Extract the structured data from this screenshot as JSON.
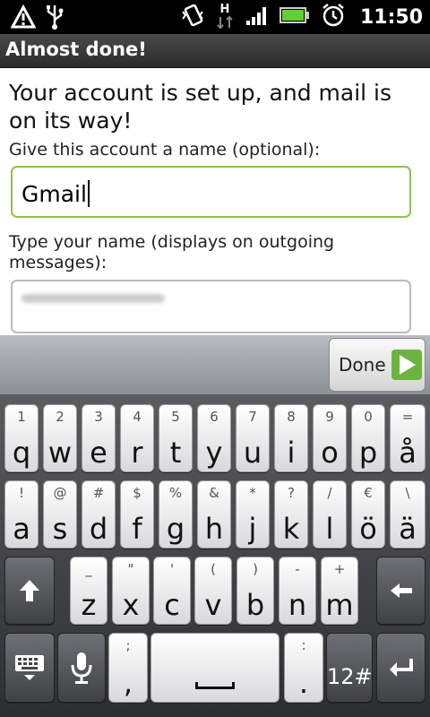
{
  "status_bar": {
    "time": "11:50",
    "icons": [
      "warning-icon",
      "usb-icon",
      "vibrate-icon",
      "data-h-icon",
      "signal-icon",
      "battery-icon",
      "alarm-icon"
    ],
    "network_type": "H"
  },
  "title_bar": {
    "title": "Almost done!"
  },
  "content": {
    "heading": "Your account is set up, and mail is on its way!",
    "account_name_label": "Give this account a name (optional):",
    "account_name_value": "Gmail",
    "your_name_label": "Type your name (displays on outgoing messages):"
  },
  "keyboard": {
    "done_label": "Done",
    "row1": [
      {
        "top": "1",
        "main": "q"
      },
      {
        "top": "2",
        "main": "w"
      },
      {
        "top": "3",
        "main": "e"
      },
      {
        "top": "4",
        "main": "r"
      },
      {
        "top": "5",
        "main": "t"
      },
      {
        "top": "6",
        "main": "y"
      },
      {
        "top": "7",
        "main": "u"
      },
      {
        "top": "8",
        "main": "i"
      },
      {
        "top": "9",
        "main": "o"
      },
      {
        "top": "0",
        "main": "p"
      },
      {
        "top": "=",
        "main": "å"
      }
    ],
    "row2": [
      {
        "top": "!",
        "main": "a"
      },
      {
        "top": "@",
        "main": "s"
      },
      {
        "top": "#",
        "main": "d"
      },
      {
        "top": "$",
        "main": "f"
      },
      {
        "top": "%",
        "main": "g"
      },
      {
        "top": "&",
        "main": "h"
      },
      {
        "top": "*",
        "main": "j"
      },
      {
        "top": "?",
        "main": "k"
      },
      {
        "top": "/",
        "main": "l"
      },
      {
        "top": "€",
        "main": "ö"
      },
      {
        "top": "\\",
        "main": "ä"
      }
    ],
    "row3": [
      {
        "top": "_",
        "main": "z"
      },
      {
        "top": "\"",
        "main": "x"
      },
      {
        "top": "'",
        "main": "c"
      },
      {
        "top": "(",
        "main": "v"
      },
      {
        "top": ")",
        "main": "b"
      },
      {
        "top": "-",
        "main": "n"
      },
      {
        "top": "+",
        "main": "m"
      }
    ],
    "row4": {
      "comma": {
        "top": ";",
        "main": ","
      },
      "period": {
        "top": ":",
        "main": "."
      },
      "numbers_label": "12#"
    }
  },
  "colors": {
    "focus_border": "#8bc34a",
    "done_arrow": "#6db33f",
    "title_bar": "#333333"
  }
}
